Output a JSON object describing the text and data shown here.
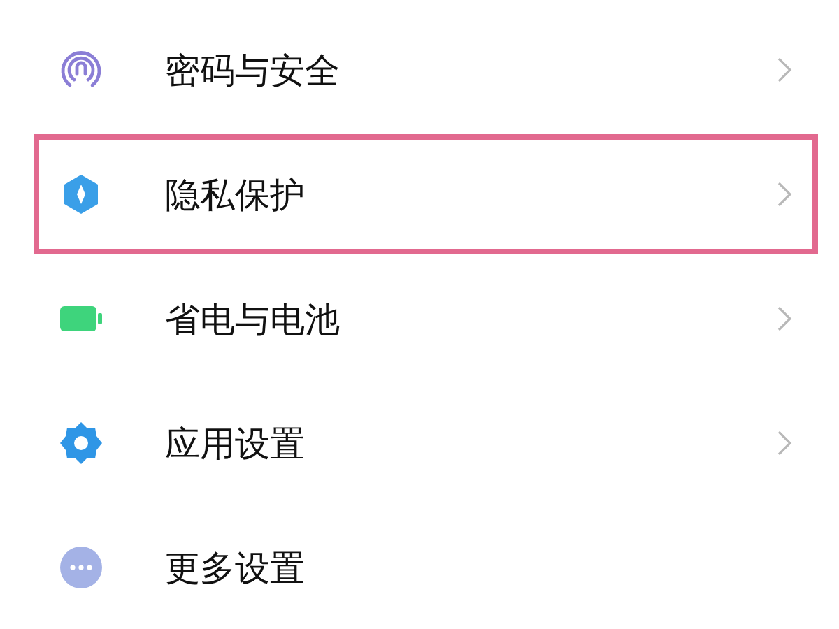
{
  "items": [
    {
      "kind": "fingerprint",
      "label": "密码与安全",
      "chevron": true,
      "highlighted": false
    },
    {
      "kind": "privacy",
      "label": "隐私保护",
      "chevron": true,
      "highlighted": true
    },
    {
      "kind": "battery",
      "label": "省电与电池",
      "chevron": true,
      "highlighted": false
    },
    {
      "kind": "gear",
      "label": "应用设置",
      "chevron": true,
      "highlighted": false
    },
    {
      "kind": "more",
      "label": "更多设置",
      "chevron": false,
      "highlighted": false
    }
  ]
}
